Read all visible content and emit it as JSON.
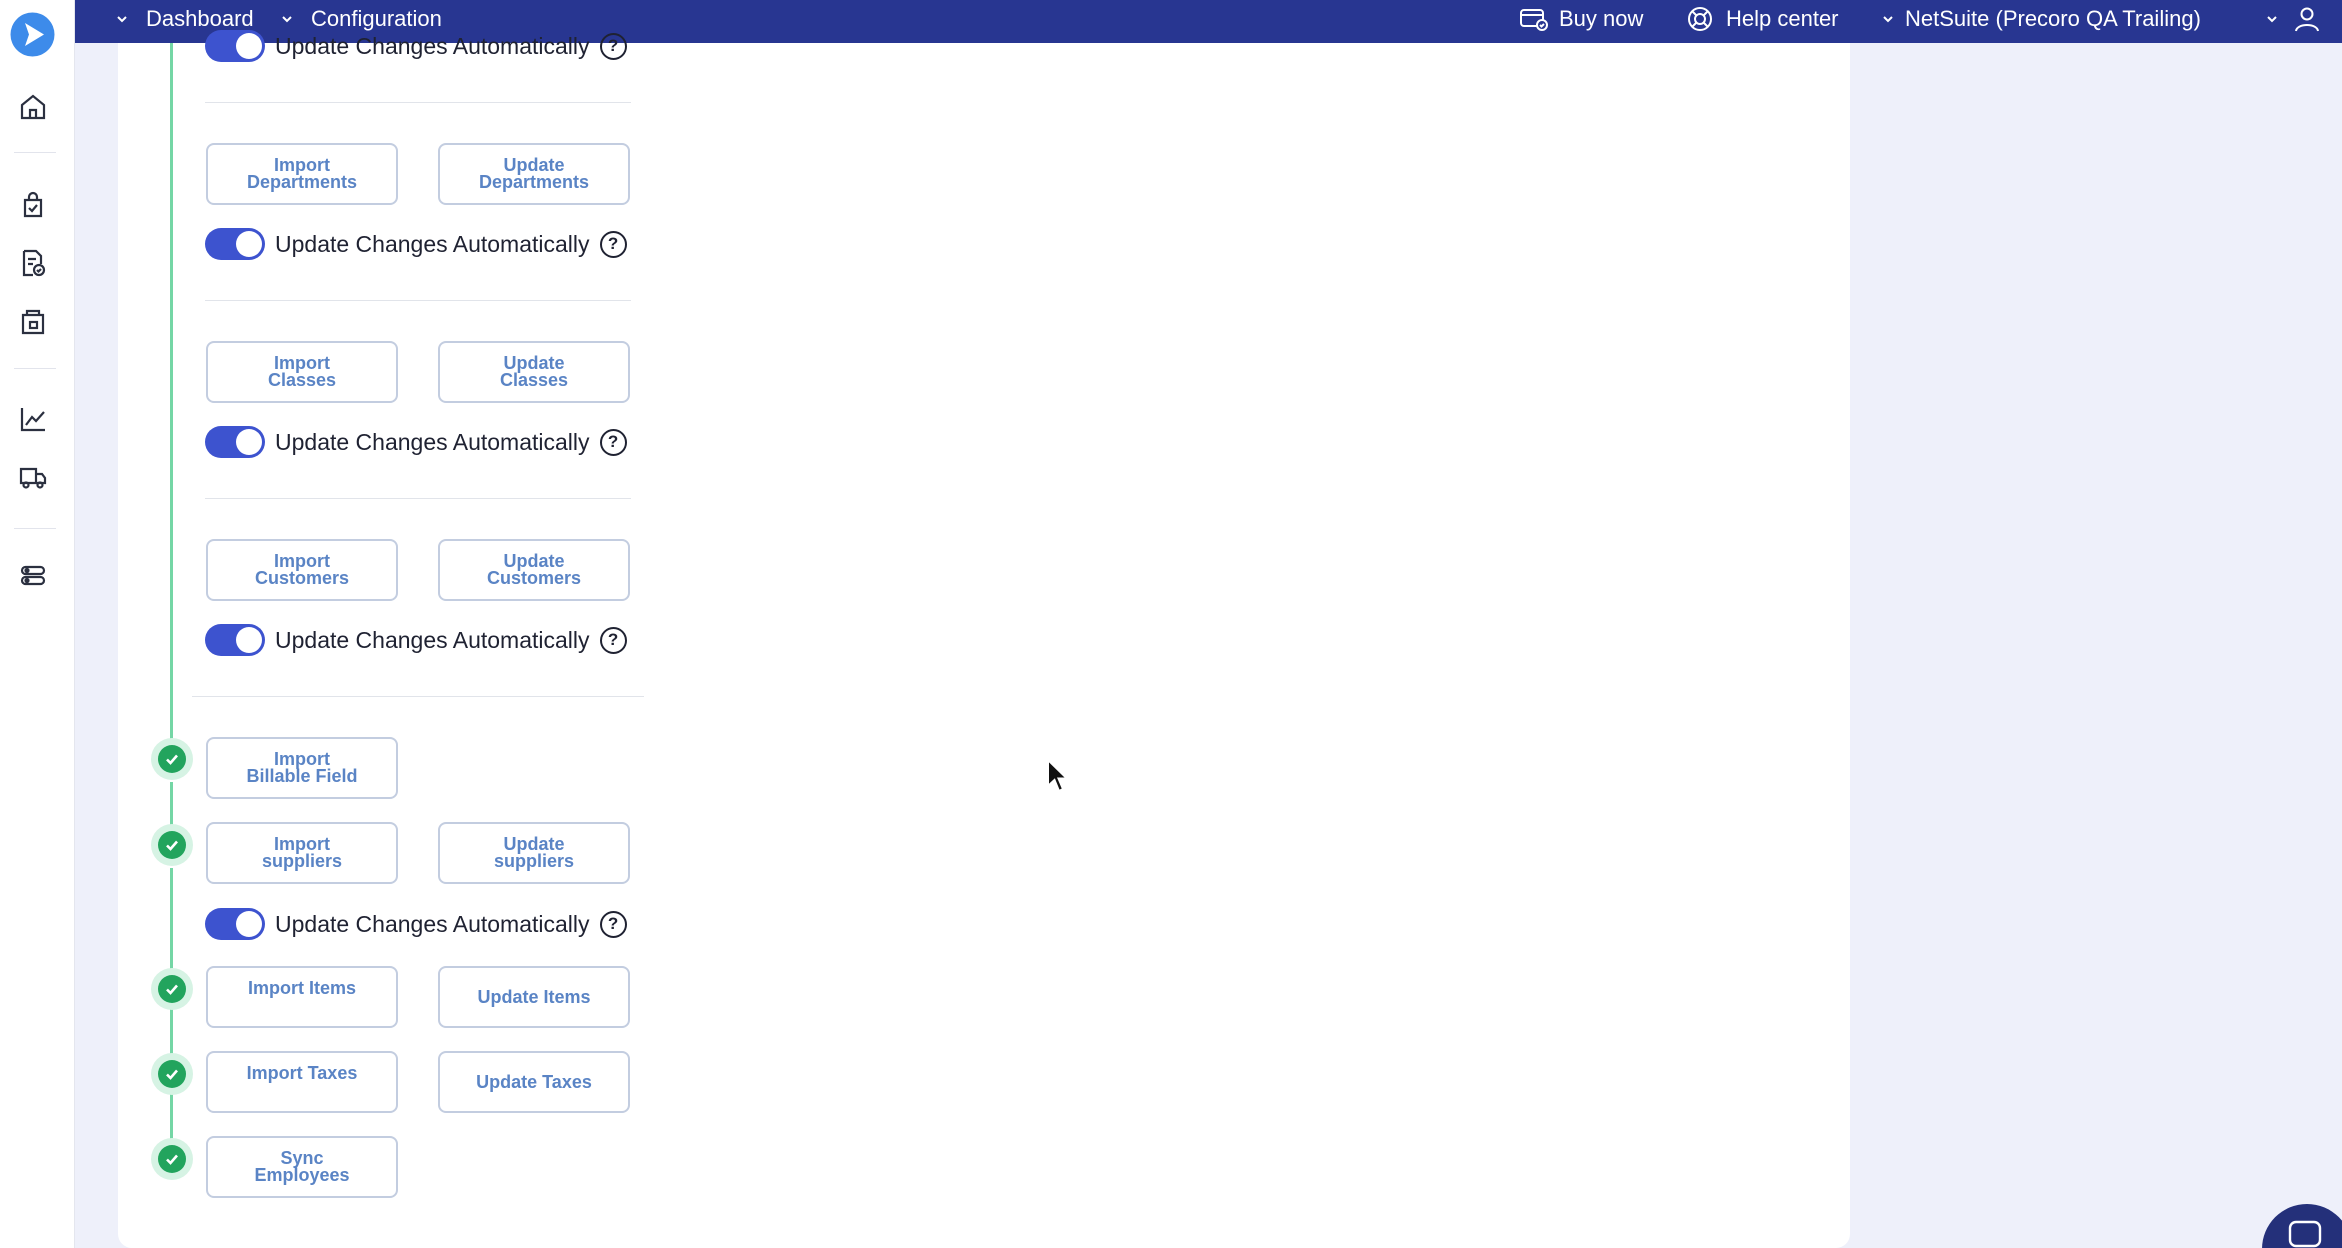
{
  "topbar": {
    "dashboard": "Dashboard",
    "configuration": "Configuration",
    "buy_now": "Buy now",
    "help_center": "Help center",
    "company": "NetSuite (Precoro QA Trailing)"
  },
  "toggle_label": "Update Changes Automatically",
  "help_symbol": "?",
  "buttons": {
    "import_departments": "Import\nDepartments",
    "update_departments": "Update\nDepartments",
    "import_classes": "Import\nClasses",
    "update_classes": "Update\nClasses",
    "import_customers": "Import\nCustomers",
    "update_customers": "Update\nCustomers",
    "import_billable": "Import\nBillable Field",
    "import_suppliers": "Import\nsuppliers",
    "update_suppliers": "Update\nsuppliers",
    "import_items": "Import Items",
    "update_items": "Update Items",
    "import_taxes": "Import Taxes",
    "update_taxes": "Update Taxes",
    "sync_employees": "Sync\nEmployees"
  },
  "colors": {
    "topbar": "#283691",
    "toggle_on": "#3d53cf",
    "button_text": "#5a84c5",
    "check": "#22a45d",
    "timeline": "#74d6a5"
  }
}
